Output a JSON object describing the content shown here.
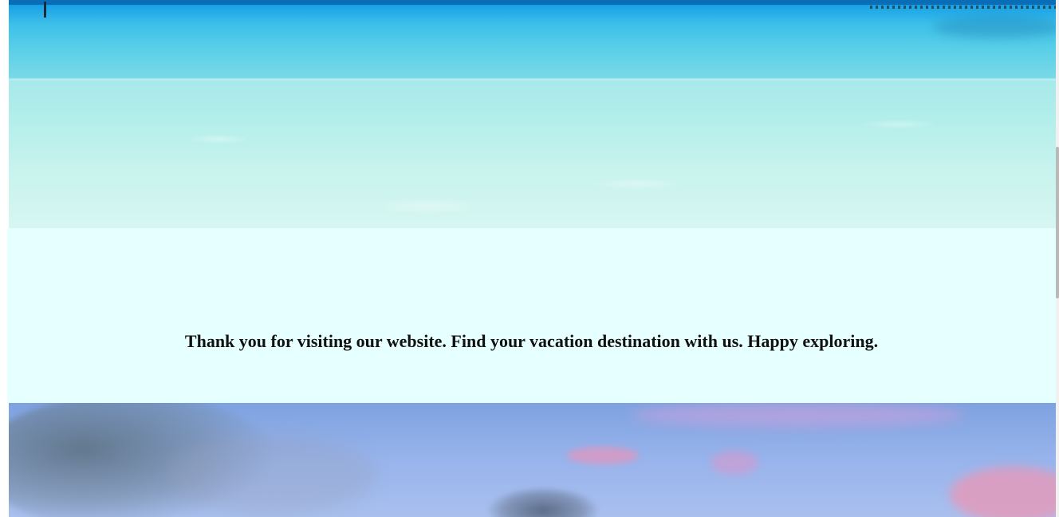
{
  "images": {
    "top": {
      "subject": "turquoise-shallow-sea"
    },
    "bottom": {
      "subject": "pastel-sunset-sky"
    }
  },
  "message": {
    "text": "Thank you for visiting our website. Find your vacation destination with us. Happy exploring."
  },
  "colors": {
    "message_background": "#e6ffff",
    "message_text": "#111111",
    "sea_deep": "#0a86d6",
    "sea_shallow": "#c7f3ee",
    "sky": "#98b4ec"
  }
}
